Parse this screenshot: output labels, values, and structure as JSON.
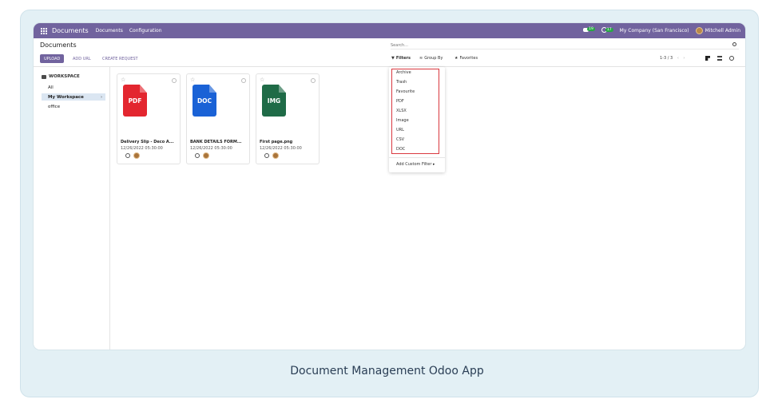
{
  "navbar": {
    "app_name": "Documents",
    "menu": [
      "Documents",
      "Configuration"
    ],
    "chat_badge": "19",
    "activity_badge": "17",
    "company": "My Company (San Francisco)",
    "user": "Mitchell Admin"
  },
  "control": {
    "breadcrumb": "Documents",
    "upload_label": "UPLOAD",
    "add_url_label": "ADD URL",
    "create_request_label": "CREATE REQUEST",
    "search_placeholder": "Search...",
    "filters_label": "Filters",
    "group_by_label": "Group By",
    "favorites_label": "Favorites",
    "pager": "1-3 / 3"
  },
  "sidebar": {
    "title": "WORKSPACE",
    "items": [
      {
        "label": "All"
      },
      {
        "label": "My Workspace"
      },
      {
        "label": "office"
      }
    ]
  },
  "cards": [
    {
      "badge": "PDF",
      "name": "Delivery Slip - Deco A...",
      "date": "12/26/2022 05:30:00",
      "color": "#e3262f"
    },
    {
      "badge": "DOC",
      "name": "BANK DETAILS FORM...",
      "date": "12/26/2022 05:30:00",
      "color": "#1a62d6"
    },
    {
      "badge": "IMG",
      "name": "First page.png",
      "date": "12/26/2022 05:30:00",
      "color": "#1f6b47"
    }
  ],
  "filters_dropdown": {
    "items": [
      "Archive",
      "Trash",
      "Favourite",
      "PDF",
      "XLSX",
      "Image",
      "URL",
      "CSV",
      "DOC"
    ],
    "custom": "Add Custom Filter"
  },
  "caption": "Document Management Odoo App",
  "colors": {
    "brand": "#71639e",
    "highlight": "#d9383f",
    "frame": "#e3f0f5"
  }
}
